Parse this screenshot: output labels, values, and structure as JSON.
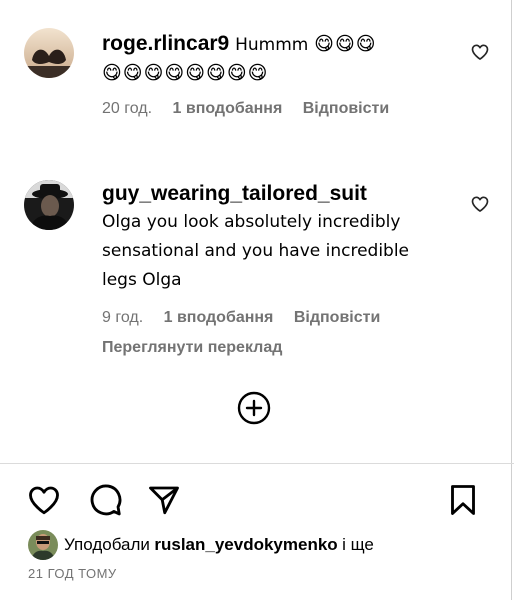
{
  "comments": [
    {
      "username": "roge.rlincar9",
      "text": "Hummm",
      "emoji_line1": "😋😋😋",
      "emoji_line2": "😋😋😋😋😋😋😋😋",
      "time": "20 год.",
      "likes": "1 вподобання",
      "reply": "Відповісти"
    },
    {
      "username": "guy_wearing_tailored_suit",
      "text_lines": [
        "Olga you look absolutely incredibly",
        "sensational and you have incredible",
        "legs Olga"
      ],
      "time": "9 год.",
      "likes": "1 вподобання",
      "reply": "Відповісти",
      "translate": "Переглянути переклад"
    }
  ],
  "actions": {
    "like_icon": "heart-outline-icon",
    "comment_icon": "speech-bubble-icon",
    "share_icon": "paper-plane-icon",
    "save_icon": "bookmark-icon"
  },
  "liked_by": {
    "prefix": "Уподобали",
    "user": "ruslan_yevdokymenko",
    "suffix": "і ще"
  },
  "post_time": "21 ГОД ТОМУ",
  "colors": {
    "secondary_text": "#737373",
    "divider": "#dbdbdb",
    "text": "#000000"
  }
}
